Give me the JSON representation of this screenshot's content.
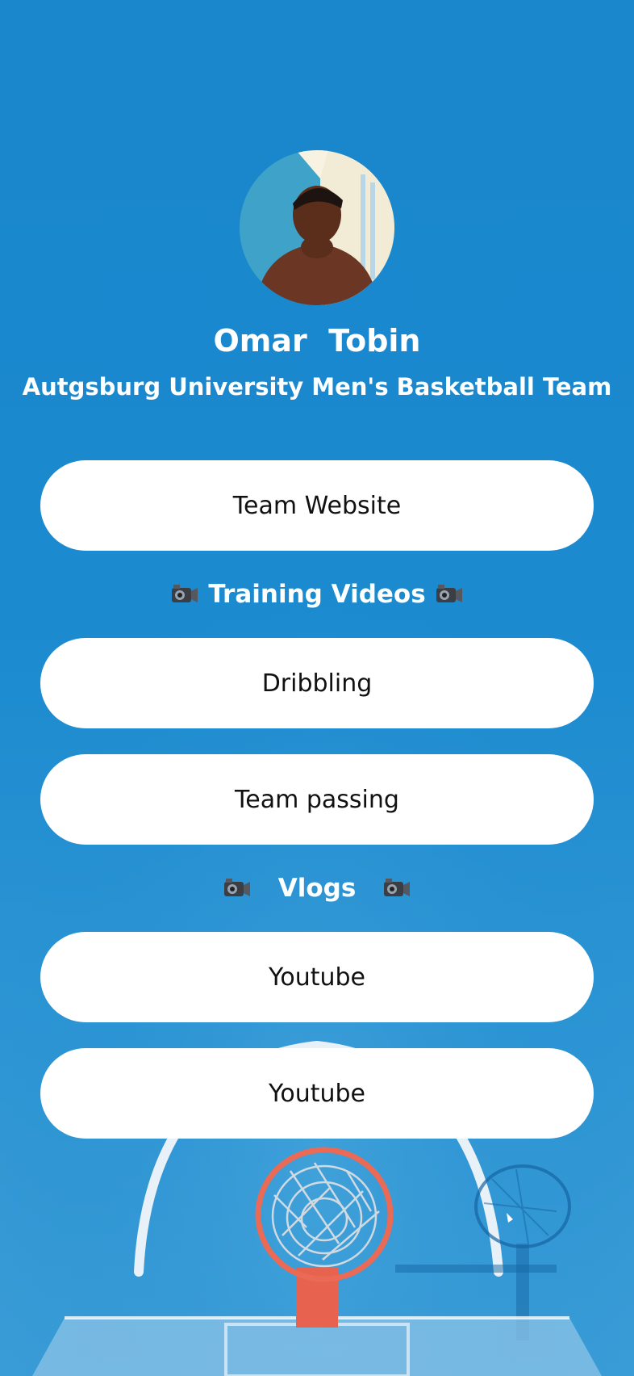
{
  "profile": {
    "name": "Omar  Tobin",
    "subtitle": "Autgsburg University Men's Basketball Team"
  },
  "links": {
    "team_website": "Team Website",
    "dribbling": "Dribbling",
    "team_passing": "Team passing",
    "youtube_1": "Youtube",
    "youtube_2": "Youtube"
  },
  "sections": {
    "training_videos": "Training Videos",
    "vlogs": "Vlogs"
  },
  "icons": {
    "section_icon": "video-camera-icon"
  },
  "colors": {
    "background": "#1b8acf",
    "button_bg": "#ffffff",
    "button_text": "#111111",
    "header_text": "#ffffff",
    "hoop_rim": "#e8634f"
  }
}
